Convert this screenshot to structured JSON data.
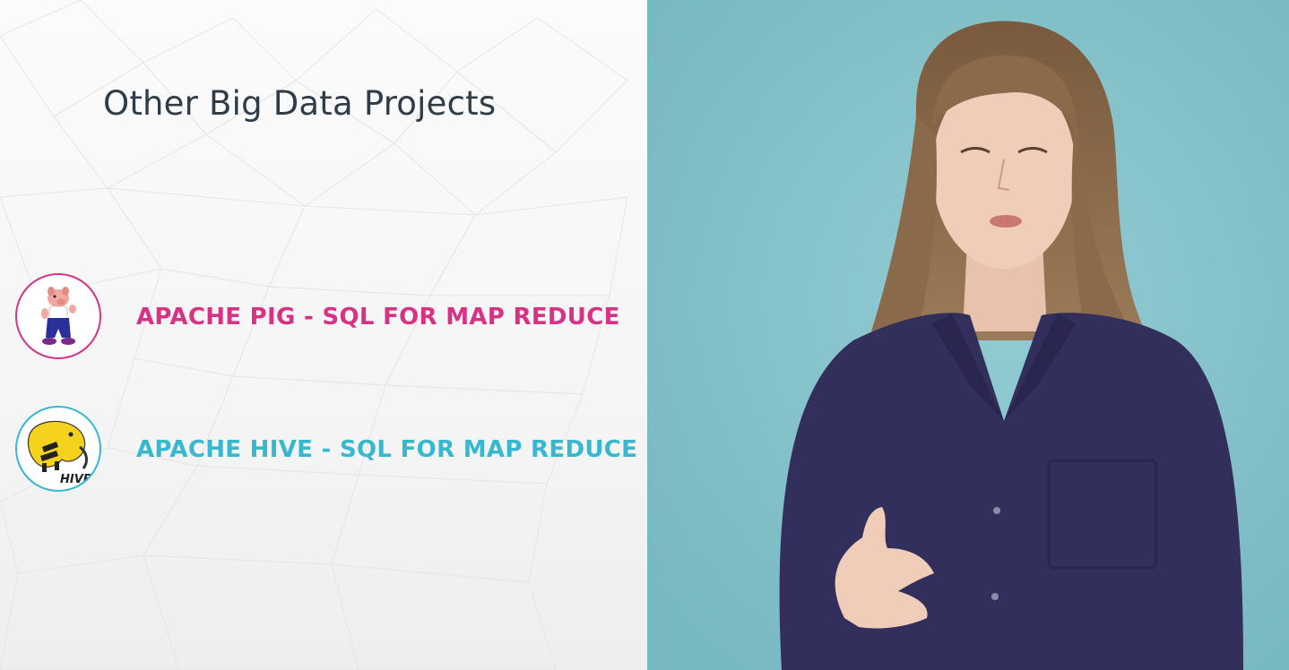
{
  "slide": {
    "title": "Other Big Data Projects",
    "projects": [
      {
        "label": "APACHE PIG - SQL FOR MAP REDUCE",
        "icon": "pig-logo-icon",
        "color": "#d63384"
      },
      {
        "label": "APACHE HIVE - SQL FOR MAP REDUCE",
        "icon": "hive-logo-icon",
        "color": "#35b8d0"
      }
    ],
    "hive_logo_text": "HIVE"
  },
  "colors": {
    "title": "#2e3d49",
    "video_background": "#86c4cc",
    "shirt": "#332f5c",
    "hair": "#8a6a4a"
  },
  "video": {
    "icon": "presenter-video-icon"
  }
}
